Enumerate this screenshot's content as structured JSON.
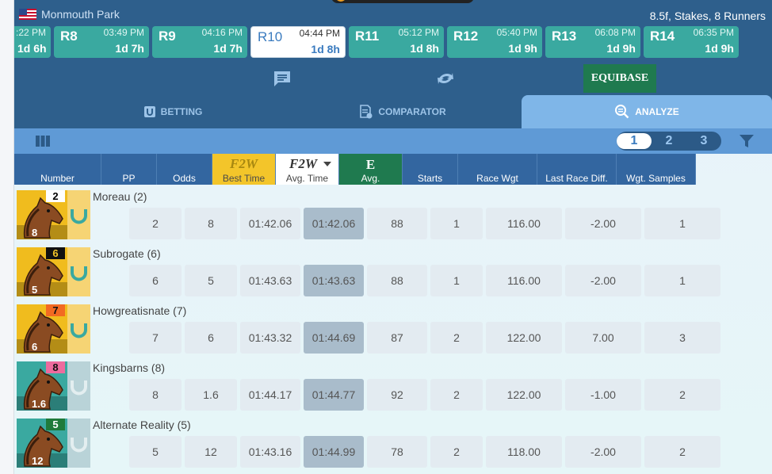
{
  "header": {
    "track": "Monmouth Park",
    "race_info": "8.5f, Stakes, 8 Runners"
  },
  "race_tabs": [
    {
      "label": "",
      "time": ":22 PM",
      "countdown": "1d 6h"
    },
    {
      "label": "R8",
      "time": "03:49 PM",
      "countdown": "1d 7h"
    },
    {
      "label": "R9",
      "time": "04:16 PM",
      "countdown": "1d 7h"
    },
    {
      "label": "R10",
      "time": "04:44 PM",
      "countdown": "1d 8h"
    },
    {
      "label": "R11",
      "time": "05:12 PM",
      "countdown": "1d 8h"
    },
    {
      "label": "R12",
      "time": "05:40 PM",
      "countdown": "1d 9h"
    },
    {
      "label": "R13",
      "time": "06:08 PM",
      "countdown": "1d 9h"
    },
    {
      "label": "R14",
      "time": "06:35 PM",
      "countdown": "1d 9h"
    }
  ],
  "toolbar": {
    "equibase_label": "EQUIBASE"
  },
  "main_tabs": {
    "betting": "BETTING",
    "comparator": "COMPARATOR",
    "analyze": "ANALYZE"
  },
  "pager": [
    "1",
    "2",
    "3"
  ],
  "columns": {
    "number": "Number",
    "pp": "PP",
    "odds": "Odds",
    "best_time": "Best Time",
    "avg_time": "Avg. Time",
    "avg": "Avg.",
    "starts": "Starts",
    "race_wgt": "Race Wgt",
    "last_race_diff": "Last Race Diff.",
    "wgt_samples": "Wgt. Samples"
  },
  "column_logos": {
    "f2w": "F2W",
    "equibase": "E"
  },
  "colors": {
    "header": "#2e5f8c",
    "race_tab": "#3aa9a0",
    "highlight_cell": "#a9bccb"
  },
  "horses": [
    {
      "name": "Moreau (2)",
      "pp": "2",
      "odds": "8",
      "best_time": "01:42.06",
      "avg_time": "01:42.06",
      "avg": "88",
      "starts": "1",
      "race_wgt": "116.00",
      "last_race_diff": "-2.00",
      "wgt_samples": "1",
      "badge_color": "#ffffff",
      "badge_text_color": "#000000",
      "bg_color": "#f0bc1e"
    },
    {
      "name": "Subrogate (6)",
      "pp": "6",
      "odds": "5",
      "best_time": "01:43.63",
      "avg_time": "01:43.63",
      "avg": "88",
      "starts": "1",
      "race_wgt": "116.00",
      "last_race_diff": "-2.00",
      "wgt_samples": "1",
      "badge_color": "#111111",
      "badge_text_color": "#f3c52a",
      "bg_color": "#f0bc1e"
    },
    {
      "name": "Howgreatisnate (7)",
      "pp": "7",
      "odds": "6",
      "best_time": "01:43.32",
      "avg_time": "01:44.69",
      "avg": "87",
      "starts": "2",
      "race_wgt": "122.00",
      "last_race_diff": "7.00",
      "wgt_samples": "3",
      "badge_color": "#f26a22",
      "badge_text_color": "#111111",
      "bg_color": "#f0bc1e"
    },
    {
      "name": "Kingsbarns (8)",
      "pp": "8",
      "odds": "1.6",
      "best_time": "01:44.17",
      "avg_time": "01:44.77",
      "avg": "92",
      "starts": "2",
      "race_wgt": "122.00",
      "last_race_diff": "-1.00",
      "wgt_samples": "2",
      "badge_color": "#ee6b9e",
      "badge_text_color": "#111111",
      "bg_color": "#3aa9a0"
    },
    {
      "name": "Alternate Reality (5)",
      "pp": "5",
      "odds": "12",
      "best_time": "01:43.16",
      "avg_time": "01:44.99",
      "avg": "78",
      "starts": "2",
      "race_wgt": "118.00",
      "last_race_diff": "-2.00",
      "wgt_samples": "2",
      "badge_color": "#1f7a3a",
      "badge_text_color": "#ffffff",
      "bg_color": "#3aa9a0"
    }
  ]
}
